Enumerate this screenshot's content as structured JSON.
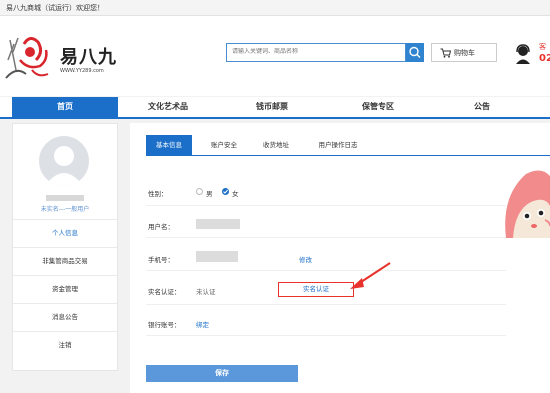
{
  "topbar": {
    "welcome": "易八九商城（试运行）欢迎您！"
  },
  "header": {
    "logo_name": "易八九",
    "logo_url": "WWW.YY289.com",
    "search_placeholder": "请输入关键词、商品名称",
    "cart_label": "购物车",
    "customer_service_text": "客",
    "customer_service_number": "02"
  },
  "nav": {
    "items": [
      {
        "label": "首页",
        "active": true
      },
      {
        "label": "文化艺术品"
      },
      {
        "label": "钱币邮票"
      },
      {
        "label": "保管专区"
      },
      {
        "label": "公告"
      }
    ]
  },
  "sidebar": {
    "user_level": "未实名---一般用户",
    "items": [
      {
        "label": "个人信息",
        "active": true
      },
      {
        "label": "非集管商品交易"
      },
      {
        "label": "资金管理"
      },
      {
        "label": "消息公告"
      },
      {
        "label": "注销"
      }
    ]
  },
  "tabs": [
    {
      "label": "基本信息",
      "active": true
    },
    {
      "label": "账户安全"
    },
    {
      "label": "收货地址"
    },
    {
      "label": "用户操作日志"
    }
  ],
  "form": {
    "gender_label": "性别：",
    "gender_male": "男",
    "gender_female": "女",
    "gender_selected": "女",
    "username_label": "用户名：",
    "phone_label": "手机号：",
    "phone_modify": "修改",
    "realname_label": "实名认证：",
    "realname_status": "未认证",
    "realname_button": "实名认证",
    "bank_label": "银行账号：",
    "bank_bind": "绑定",
    "save_button": "保存"
  },
  "colors": {
    "brand_blue": "#1b6fc8",
    "accent_red": "#e8322b",
    "save_blue": "#5a97db"
  }
}
